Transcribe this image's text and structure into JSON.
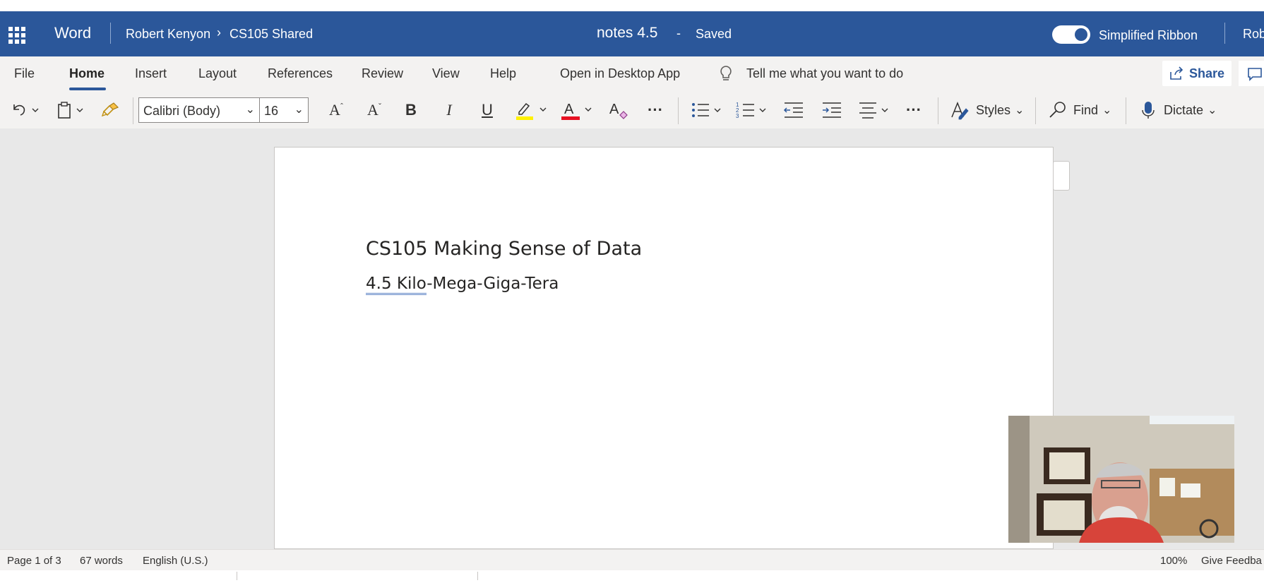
{
  "titlebar": {
    "app_name": "Word",
    "owner": "Robert Kenyon",
    "breadcrumb_sep": "›",
    "folder": "CS105 Shared",
    "doc_title": "notes 4.5",
    "title_sep": "-",
    "save_status": "Saved",
    "simplified_ribbon_label": "Simplified Ribbon",
    "user_truncated": "Rob"
  },
  "menu": {
    "items": [
      "File",
      "Home",
      "Insert",
      "Layout",
      "References",
      "Review",
      "View",
      "Help"
    ],
    "active": "Home",
    "open_desktop": "Open in Desktop App",
    "tell_me": "Tell me what you want to do",
    "share": "Share"
  },
  "toolbar": {
    "font_name": "Calibri (Body)",
    "font_size": "16",
    "bold": "B",
    "italic": "I",
    "underline": "U",
    "styles_label": "Styles",
    "find_label": "Find",
    "dictate_label": "Dictate",
    "more": "···",
    "font_color": "#e81123",
    "highlight_color": "#fff100"
  },
  "document": {
    "title": "CS105 Making Sense of Data",
    "subtitle_part1": "4.5  Kilo",
    "subtitle_part2": "-Mega-Giga-Tera"
  },
  "statusbar": {
    "page": "Page 1 of 3",
    "words": "67 words",
    "language": "English (U.S.)",
    "zoom": "100%",
    "feedback": "Give Feedba"
  },
  "colors": {
    "brand": "#2b579a",
    "ribbon_bg": "#f3f2f1",
    "canvas_bg": "#e8e8e8"
  }
}
